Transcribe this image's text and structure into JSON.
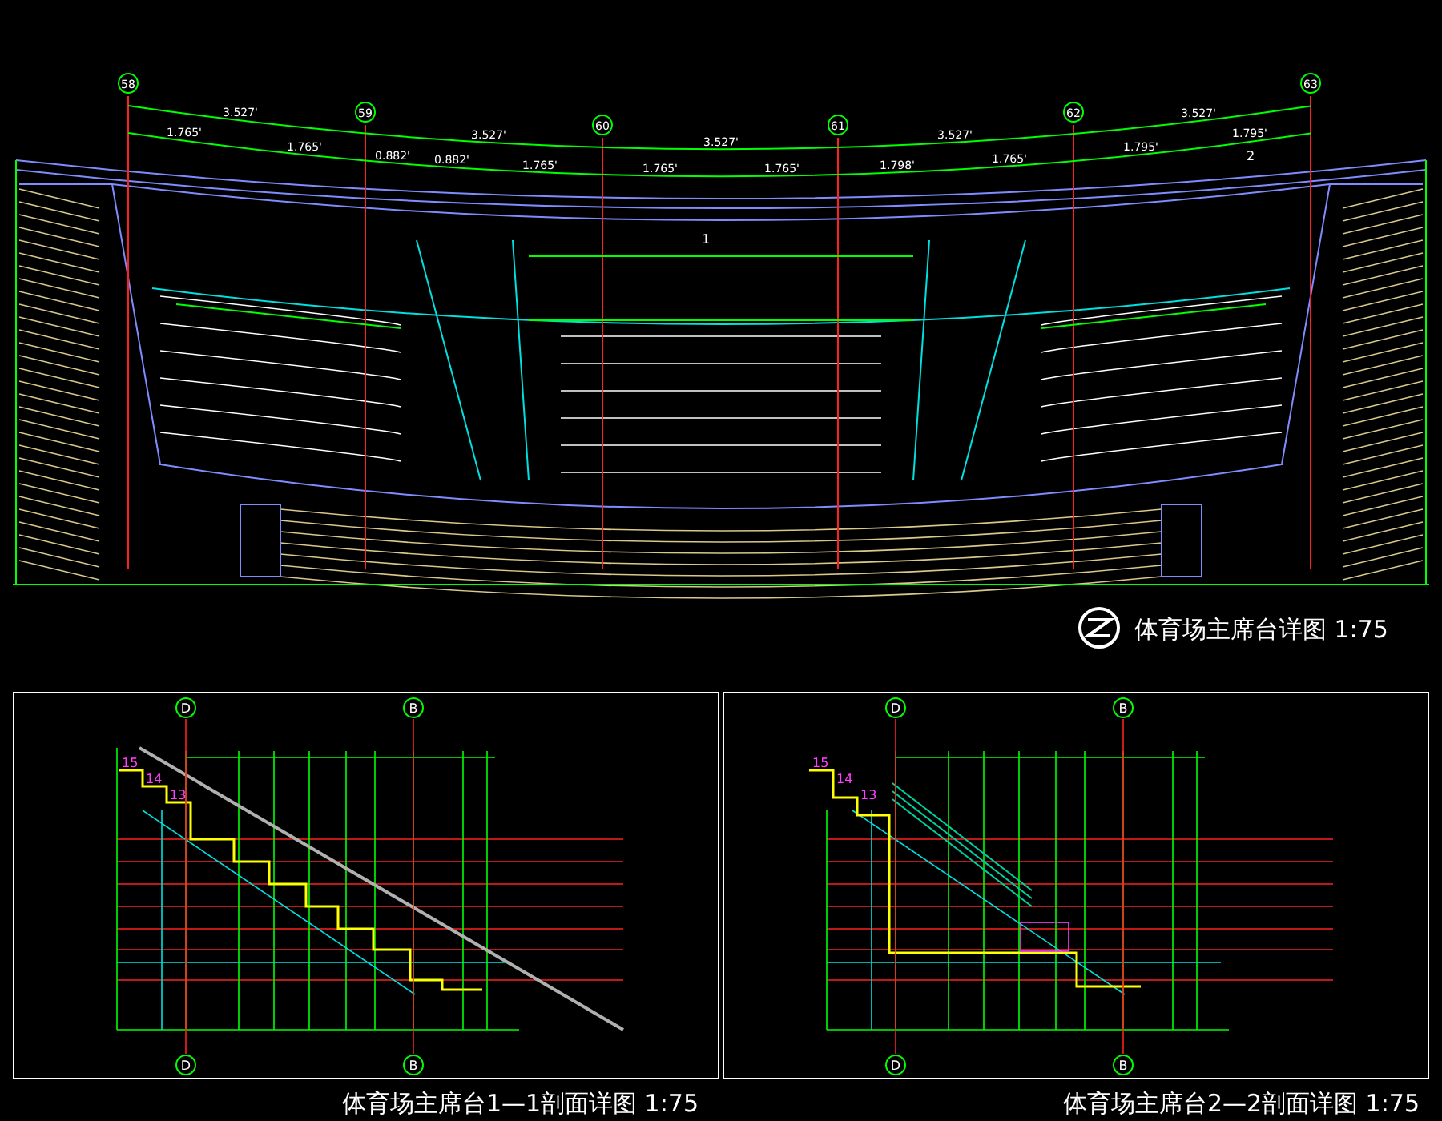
{
  "plan": {
    "axis_labels": [
      "58",
      "59",
      "60",
      "61",
      "62",
      "63"
    ],
    "dimensions_outer": [
      "3.527'",
      "3.527'",
      "3.527'",
      "3.527'",
      "3.527'"
    ],
    "dimensions_inner": [
      "1.765'",
      "1.765'",
      "0.882'",
      "0.882'",
      "1.765'",
      "1.765'",
      "1.765'",
      "1.798'",
      "1.765'",
      "1.795'",
      "1.795'"
    ],
    "section_marks": [
      "1",
      "2"
    ],
    "title": "体育场主席台详图 1:75"
  },
  "sections": [
    {
      "kind": "stair",
      "axis_labels_top": [
        "D",
        "B"
      ],
      "axis_labels_bottom": [
        "D",
        "B"
      ],
      "step_labels": [
        "15",
        "14",
        "13"
      ],
      "title": "体育场主席台1—1剖面详图 1:75"
    },
    {
      "kind": "railing",
      "axis_labels_top": [
        "D",
        "B"
      ],
      "axis_labels_bottom": [
        "D",
        "B"
      ],
      "step_labels": [
        "15",
        "14",
        "13"
      ],
      "title": "体育场主席台2—2剖面详图 1:75"
    }
  ]
}
